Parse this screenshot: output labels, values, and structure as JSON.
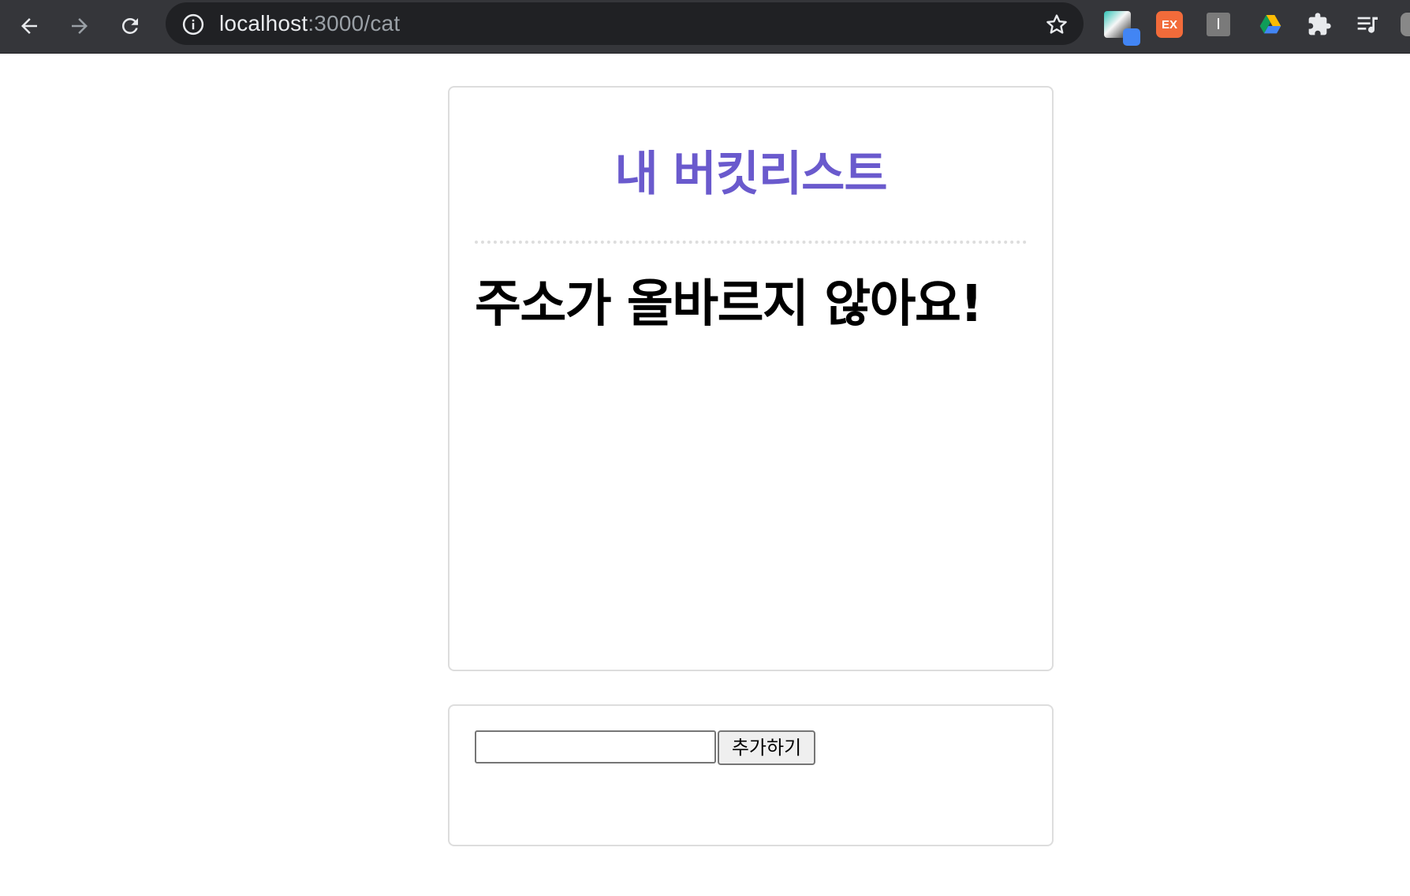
{
  "browser": {
    "url_host": "localhost",
    "url_rest": ":3000/cat",
    "icons": {
      "back": "arrow-left-icon",
      "forward": "arrow-right-icon",
      "reload": "reload-icon",
      "info": "info-icon",
      "bookmark": "star-icon",
      "extensions": "puzzle-icon",
      "media": "media-controls-icon"
    },
    "extensions": {
      "ex_label": "EX",
      "i_label": "I"
    }
  },
  "page": {
    "title": "내 버킷리스트",
    "message": "주소가 올바르지 않아요!",
    "form": {
      "input_value": "",
      "add_button_label": "추가하기"
    }
  },
  "colors": {
    "title": "#6a5acd",
    "card_border": "#dddddd",
    "chrome_bg": "#35363a",
    "omnibox_bg": "#202124",
    "ex_badge": "#f26b3a"
  }
}
